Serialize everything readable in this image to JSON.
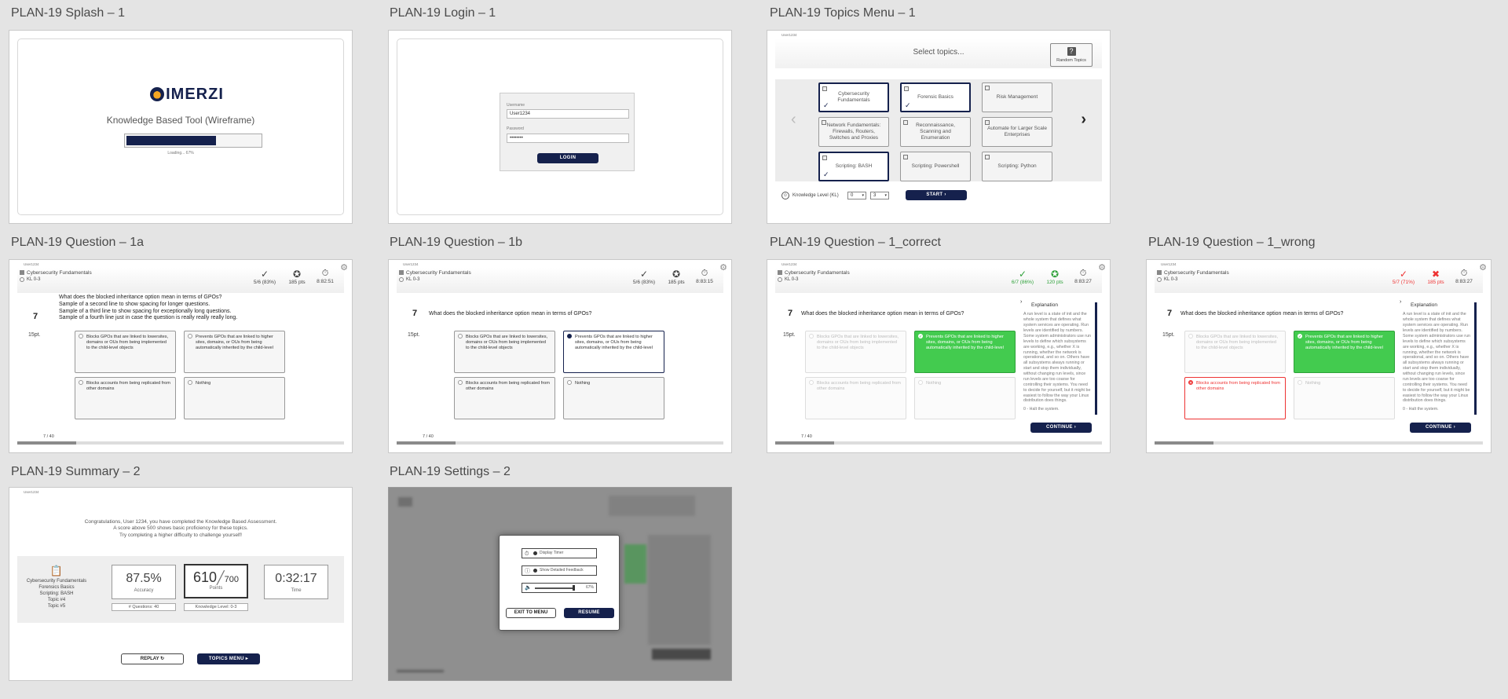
{
  "frames": {
    "splash": {
      "title": "PLAN-19 Splash – 1",
      "logo_text": "IMERZI",
      "subtitle": "Knowledge Based Tool (Wireframe)",
      "loading_text": "Loading... 67%",
      "progress_value": 0.67
    },
    "login": {
      "title": "PLAN-19 Login – 1",
      "username_label": "Username",
      "username_value": "User1234",
      "password_label": "Password",
      "password_value": "••••••••",
      "login_button": "LOGIN"
    },
    "topics": {
      "title": "PLAN-19 Topics Menu – 1",
      "user": "User1234",
      "heading": "Select topics...",
      "random_button": "Random Topics",
      "tiles": [
        {
          "label": "Cybersecurity Fundamentals",
          "selected": true
        },
        {
          "label": "Forensic Basics",
          "selected": true
        },
        {
          "label": "Risk Management",
          "selected": false
        },
        {
          "label": "Network Fundamentals: Firewalls, Routers, Switches and Proxies",
          "selected": false
        },
        {
          "label": "Reconnaissance, Scanning and Enumeration",
          "selected": false
        },
        {
          "label": "Automate for Larger Scale Enterprises",
          "selected": false
        },
        {
          "label": "Scripting: BASH",
          "selected": true
        },
        {
          "label": "Scripting: Powershell",
          "selected": false
        },
        {
          "label": "Scripting: Python",
          "selected": false
        }
      ],
      "kl_label": "Knowledge Level (KL)",
      "kl_from": "0",
      "kl_to": "3",
      "start_button": "START"
    },
    "q1a": {
      "title": "PLAN-19 Question – 1a",
      "user": "User1234",
      "topic": "Cybersecurity Fundamentals",
      "kl": "KL 0-3",
      "score": "5/6 (83%)",
      "points": "185 pts",
      "time": "8:82:51",
      "question_no": "7",
      "question_lines": [
        "What does the blocked inheritance option mean in terms of GPOs?",
        "Sample of a second line to show spacing for longer questions.",
        "Sample of a third line to show spacing for exceptionally long questions.",
        "Sample of a fourth line just in case the question is really really really long."
      ],
      "pts": "15pt.",
      "counter": "7 / 40"
    },
    "q1b": {
      "title": "PLAN-19 Question – 1b",
      "user": "User1234",
      "topic": "Cybersecurity Fundamentals",
      "kl": "KL 0-3",
      "score": "5/6 (83%)",
      "points": "185 pts",
      "time": "8:83:15",
      "question_no": "7",
      "question": "What does the blocked inheritance option mean in terms of GPOs?",
      "pts": "15pt.",
      "counter": "7 / 40"
    },
    "qcorrect": {
      "title": "PLAN-19 Question – 1_correct",
      "user": "User1234",
      "topic": "Cybersecurity Fundamentals",
      "kl": "KL 0-3",
      "score": "6/7 (86%)",
      "points": "120 pts",
      "time": "8:83:27",
      "question_no": "7",
      "question": "What does the blocked inheritance option mean in terms of GPOs?",
      "pts": "15pt.",
      "counter": "7 / 40",
      "continue": "CONTINUE"
    },
    "qwrong": {
      "title": "PLAN-19 Question – 1_wrong",
      "user": "User1234",
      "topic": "Cybersecurity Fundamentals",
      "kl": "KL 0-3",
      "score": "5/7 (71%)",
      "points": "185 pts",
      "time": "8:83:27",
      "question_no": "7",
      "question": "What does the blocked inheritance option mean in terms of GPOs?",
      "pts": "15pt.",
      "continue": "CONTINUE"
    },
    "summary": {
      "title": "PLAN-19 Summary – 2",
      "user": "User1234",
      "messages": [
        "Congratulations, User 1234, you have completed the Knowledge Based Assessment.",
        "A score above 500 shows basic proficiency for these topics.",
        "Try completing a higher difficulty to challenge yourself!"
      ],
      "topics": [
        "Cybersecurity Fundamentals",
        "Forensics Basics",
        "Scripting: BASH",
        "Topic #4",
        "Topic #5"
      ],
      "accuracy": "87.5%",
      "accuracy_label": "Accuracy",
      "questions": "# Questions: 40",
      "points": "610",
      "points_total": "700",
      "points_label": "Points",
      "knowledge_level": "Knowledge Level: 0-3",
      "time": "0:32:17",
      "time_label": "Time",
      "replay": "REPLAY",
      "topics_menu": "TOPICS MENU"
    },
    "settings": {
      "title": "PLAN-19 Settings – 2",
      "display_timer": "Display Timer",
      "show_feedback": "Show Detailed Feedback",
      "volume": "67%",
      "exit": "EXIT TO MENU",
      "resume": "RESUME"
    }
  },
  "answers": [
    "Blocks GPOs that are linked to lowersites, domains or OUs from being implemented to the child-level objects",
    "Prevents GPOs that are linked to higher sites, domains, or OUs from being automatically inherited by the child-level",
    "Blocks accounts from being replicated from other domains",
    "Nothing"
  ],
  "explanation": {
    "heading": "Explanation",
    "text": "A run level is a state of init and the whole system that defines what system services are operating. Run levels are identified by numbers. Some system administrators use run levels to define which subsystems are working, e.g., whether X is running, whether the network is operational, and so on. Others have all subsystems always running or start and stop them individually, without changing run levels, since run levels are too coarse for controlling their systems. You need to decide for yourself, but it might be easiest to follow the way your Linux distribution does things.",
    "footer": "0 - Halt the system."
  },
  "colors": {
    "navy": "#15214d",
    "correct": "#43cb4f",
    "wrong": "#e33333"
  }
}
